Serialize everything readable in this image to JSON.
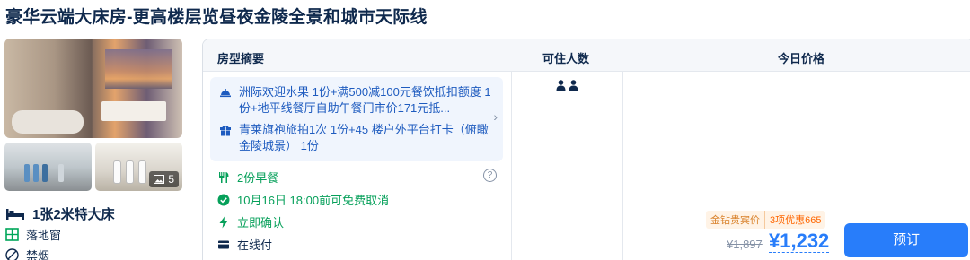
{
  "room": {
    "title": "豪华云端大床房-更高楼层览昼夜金陵全景和城市天际线",
    "photo_count": "5",
    "features": [
      {
        "icon": "bed-icon",
        "label": "1张2米特大床"
      },
      {
        "icon": "window-icon",
        "label": "落地窗"
      },
      {
        "icon": "no-smoking-icon",
        "label": "禁烟"
      }
    ]
  },
  "table": {
    "headers": {
      "summary": "房型摘要",
      "occupancy": "可住人数",
      "price": "今日价格"
    },
    "benefits": [
      {
        "icon": "hotel-bell-icon",
        "text": "洲际欢迎水果 1份+满500减100元餐饮抵扣额度 1份+地平线餐厅自助午餐门市价171元抵..."
      },
      {
        "icon": "gift-icon",
        "text": "青莱旗袍旅拍1次 1份+45 楼户外平台打卡（俯瞰金陵城景） 1份"
      }
    ],
    "policies": [
      {
        "icon": "utensils-icon",
        "text": "2份早餐"
      },
      {
        "icon": "check-circle-icon",
        "text": "10月16日 18:00前可免费取消"
      },
      {
        "icon": "lightning-icon",
        "text": "立即确认"
      },
      {
        "icon": "card-icon",
        "text": "在线付"
      }
    ],
    "occupancy": 2,
    "member_tag": "金钻贵宾价",
    "discount_tag": "3项优惠665",
    "original_price": "¥1,897",
    "price": "¥1,232",
    "book_label": "预订"
  },
  "colors": {
    "primary": "#287dfa",
    "green": "#06a05a",
    "title": "#0f294d"
  }
}
